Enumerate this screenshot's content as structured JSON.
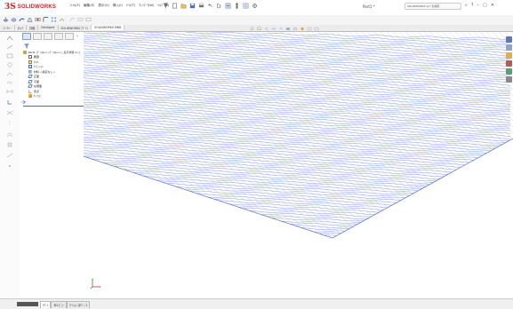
{
  "app": {
    "brand_prefix": "3S",
    "brand": "SOLIDWORKS",
    "doc_title": "Part1 *"
  },
  "menu": [
    "ﾌｧｲﾙ(F)",
    "編集(E)",
    "表示(V)",
    "挿入(I)",
    "ﾂｰﾙ(T)",
    "ｳｨﾝﾄﾞｳ(W)",
    "ﾍﾙﾌﾟ(H)"
  ],
  "search": {
    "placeholder": "SOLIDWORKS ﾍﾙﾌﾟを検索"
  },
  "window_controls": [
    "?",
    "–",
    "▢",
    "✕"
  ],
  "tabs": [
    {
      "label": "ﾌｨｰﾁｬｰ",
      "active": false
    },
    {
      "label": "ｽｹｯﾁ",
      "active": false
    },
    {
      "label": "評価",
      "active": false
    },
    {
      "label": "DimXpert",
      "active": false
    },
    {
      "label": "SOLIDWORKS ｱﾄﾞｲﾝ",
      "active": false
    },
    {
      "label": "SOLIDWORKS MBD",
      "active": true
    }
  ],
  "feature_tree": {
    "nodes": [
      {
        "label": "Part1 (ﾃﾞﾌｫﾙﾄ<<ﾃﾞﾌｫﾙﾄ>>_表示状態 1>)",
        "icon": "part-icon",
        "depth": 0
      },
      {
        "label": "履歴",
        "icon": "history-icon",
        "depth": 1
      },
      {
        "label": "ｾﾝｻｰ",
        "icon": "sensor-icon",
        "depth": 1
      },
      {
        "label": "ｱﾉﾃｰｼｮﾝ",
        "icon": "annotation-icon",
        "depth": 1
      },
      {
        "label": "材料 <指定なし>",
        "icon": "material-icon",
        "depth": 1
      },
      {
        "label": "正面",
        "icon": "plane-icon",
        "depth": 1
      },
      {
        "label": "平面",
        "icon": "plane-icon",
        "depth": 1
      },
      {
        "label": "右側面",
        "icon": "plane-icon",
        "depth": 1
      },
      {
        "label": "原点",
        "icon": "origin-icon",
        "depth": 1
      },
      {
        "label": "ｻｰﾌｪｽ",
        "icon": "surface-icon",
        "depth": 1
      }
    ]
  },
  "bottom_tabs": [
    {
      "label": "ﾓﾃﾞﾙ",
      "active": true
    },
    {
      "label": "3D ﾋﾞｭｰ",
      "active": false
    },
    {
      "label": "ﾓｰｼｮﾝ ｽﾀﾃﾞｨ 1",
      "active": false
    }
  ],
  "colors": {
    "mesh": "#3b5bd6",
    "brand": "#d32027",
    "rollback": "#3a6cd1"
  }
}
